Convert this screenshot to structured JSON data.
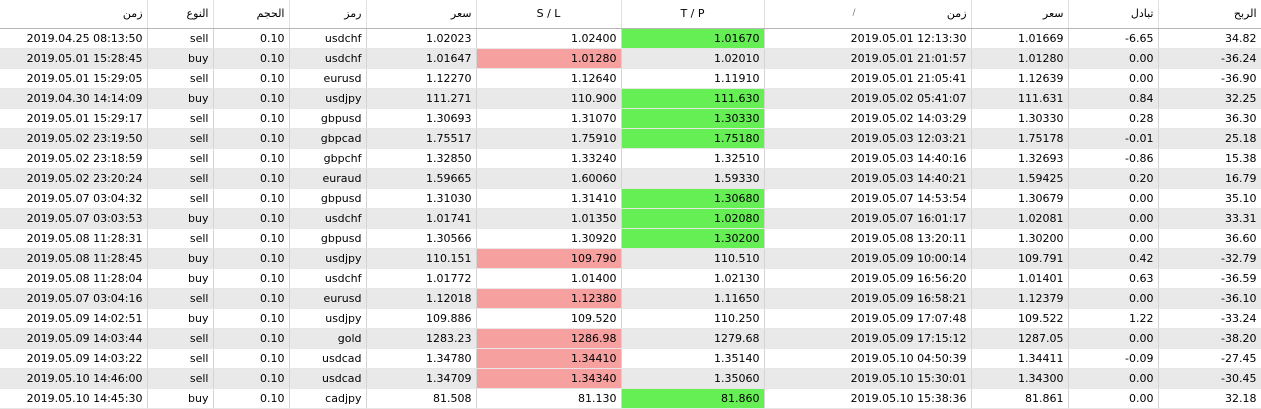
{
  "colors": {
    "header_bg": "#ffffff",
    "alt_row": "#e9e9e9",
    "sl_hit": "#f6a0a0",
    "tp_hit": "#66ee55"
  },
  "columns": [
    {
      "key": "open_time",
      "label": "زمن"
    },
    {
      "key": "type",
      "label": "النوع"
    },
    {
      "key": "volume",
      "label": "الحجم"
    },
    {
      "key": "symbol",
      "label": "رمز"
    },
    {
      "key": "open_price",
      "label": "سعر"
    },
    {
      "key": "sl",
      "label": "S / L"
    },
    {
      "key": "tp",
      "label": "T / P"
    },
    {
      "key": "close_time",
      "label": "زمن",
      "sort_icon": "/"
    },
    {
      "key": "close_price",
      "label": "سعر"
    },
    {
      "key": "swap",
      "label": "تبادل"
    },
    {
      "key": "profit",
      "label": "الربح"
    }
  ],
  "rows": [
    {
      "open_time": "2019.04.25 08:13:50",
      "type": "sell",
      "volume": "0.10",
      "symbol": "usdchf",
      "open_price": "1.02023",
      "sl": "1.02400",
      "tp": "1.01670",
      "close_time": "2019.05.01 12:13:30",
      "close_price": "1.01669",
      "swap": "-6.65",
      "profit": "34.82",
      "hit": "tp"
    },
    {
      "open_time": "2019.05.01 15:28:45",
      "type": "buy",
      "volume": "0.10",
      "symbol": "usdchf",
      "open_price": "1.01647",
      "sl": "1.01280",
      "tp": "1.02010",
      "close_time": "2019.05.01 21:01:57",
      "close_price": "1.01280",
      "swap": "0.00",
      "profit": "-36.24",
      "hit": "sl"
    },
    {
      "open_time": "2019.05.01 15:29:05",
      "type": "sell",
      "volume": "0.10",
      "symbol": "eurusd",
      "open_price": "1.12270",
      "sl": "1.12640",
      "tp": "1.11910",
      "close_time": "2019.05.01 21:05:41",
      "close_price": "1.12639",
      "swap": "0.00",
      "profit": "-36.90",
      "hit": ""
    },
    {
      "open_time": "2019.04.30 14:14:09",
      "type": "buy",
      "volume": "0.10",
      "symbol": "usdjpy",
      "open_price": "111.271",
      "sl": "110.900",
      "tp": "111.630",
      "close_time": "2019.05.02 05:41:07",
      "close_price": "111.631",
      "swap": "0.84",
      "profit": "32.25",
      "hit": "tp"
    },
    {
      "open_time": "2019.05.01 15:29:17",
      "type": "sell",
      "volume": "0.10",
      "symbol": "gbpusd",
      "open_price": "1.30693",
      "sl": "1.31070",
      "tp": "1.30330",
      "close_time": "2019.05.02 14:03:29",
      "close_price": "1.30330",
      "swap": "0.28",
      "profit": "36.30",
      "hit": "tp"
    },
    {
      "open_time": "2019.05.02 23:19:50",
      "type": "sell",
      "volume": "0.10",
      "symbol": "gbpcad",
      "open_price": "1.75517",
      "sl": "1.75910",
      "tp": "1.75180",
      "close_time": "2019.05.03 12:03:21",
      "close_price": "1.75178",
      "swap": "-0.01",
      "profit": "25.18",
      "hit": "tp"
    },
    {
      "open_time": "2019.05.02 23:18:59",
      "type": "sell",
      "volume": "0.10",
      "symbol": "gbpchf",
      "open_price": "1.32850",
      "sl": "1.33240",
      "tp": "1.32510",
      "close_time": "2019.05.03 14:40:16",
      "close_price": "1.32693",
      "swap": "-0.86",
      "profit": "15.38",
      "hit": ""
    },
    {
      "open_time": "2019.05.02 23:20:24",
      "type": "sell",
      "volume": "0.10",
      "symbol": "euraud",
      "open_price": "1.59665",
      "sl": "1.60060",
      "tp": "1.59330",
      "close_time": "2019.05.03 14:40:21",
      "close_price": "1.59425",
      "swap": "0.20",
      "profit": "16.79",
      "hit": ""
    },
    {
      "open_time": "2019.05.07 03:04:32",
      "type": "sell",
      "volume": "0.10",
      "symbol": "gbpusd",
      "open_price": "1.31030",
      "sl": "1.31410",
      "tp": "1.30680",
      "close_time": "2019.05.07 14:53:54",
      "close_price": "1.30679",
      "swap": "0.00",
      "profit": "35.10",
      "hit": "tp"
    },
    {
      "open_time": "2019.05.07 03:03:53",
      "type": "buy",
      "volume": "0.10",
      "symbol": "usdchf",
      "open_price": "1.01741",
      "sl": "1.01350",
      "tp": "1.02080",
      "close_time": "2019.05.07 16:01:17",
      "close_price": "1.02081",
      "swap": "0.00",
      "profit": "33.31",
      "hit": "tp"
    },
    {
      "open_time": "2019.05.08 11:28:31",
      "type": "sell",
      "volume": "0.10",
      "symbol": "gbpusd",
      "open_price": "1.30566",
      "sl": "1.30920",
      "tp": "1.30200",
      "close_time": "2019.05.08 13:20:11",
      "close_price": "1.30200",
      "swap": "0.00",
      "profit": "36.60",
      "hit": "tp"
    },
    {
      "open_time": "2019.05.08 11:28:45",
      "type": "buy",
      "volume": "0.10",
      "symbol": "usdjpy",
      "open_price": "110.151",
      "sl": "109.790",
      "tp": "110.510",
      "close_time": "2019.05.09 10:00:14",
      "close_price": "109.791",
      "swap": "0.42",
      "profit": "-32.79",
      "hit": "sl"
    },
    {
      "open_time": "2019.05.08 11:28:04",
      "type": "buy",
      "volume": "0.10",
      "symbol": "usdchf",
      "open_price": "1.01772",
      "sl": "1.01400",
      "tp": "1.02130",
      "close_time": "2019.05.09 16:56:20",
      "close_price": "1.01401",
      "swap": "0.63",
      "profit": "-36.59",
      "hit": ""
    },
    {
      "open_time": "2019.05.07 03:04:16",
      "type": "sell",
      "volume": "0.10",
      "symbol": "eurusd",
      "open_price": "1.12018",
      "sl": "1.12380",
      "tp": "1.11650",
      "close_time": "2019.05.09 16:58:21",
      "close_price": "1.12379",
      "swap": "0.00",
      "profit": "-36.10",
      "hit": "sl"
    },
    {
      "open_time": "2019.05.09 14:02:51",
      "type": "buy",
      "volume": "0.10",
      "symbol": "usdjpy",
      "open_price": "109.886",
      "sl": "109.520",
      "tp": "110.250",
      "close_time": "2019.05.09 17:07:48",
      "close_price": "109.522",
      "swap": "1.22",
      "profit": "-33.24",
      "hit": ""
    },
    {
      "open_time": "2019.05.09 14:03:44",
      "type": "sell",
      "volume": "0.10",
      "symbol": "gold",
      "open_price": "1283.23",
      "sl": "1286.98",
      "tp": "1279.68",
      "close_time": "2019.05.09 17:15:12",
      "close_price": "1287.05",
      "swap": "0.00",
      "profit": "-38.20",
      "hit": "sl"
    },
    {
      "open_time": "2019.05.09 14:03:22",
      "type": "sell",
      "volume": "0.10",
      "symbol": "usdcad",
      "open_price": "1.34780",
      "sl": "1.34410",
      "tp": "1.35140",
      "close_time": "2019.05.10 04:50:39",
      "close_price": "1.34411",
      "swap": "-0.09",
      "profit": "-27.45",
      "hit": "sl"
    },
    {
      "open_time": "2019.05.10 14:46:00",
      "type": "sell",
      "volume": "0.10",
      "symbol": "usdcad",
      "open_price": "1.34709",
      "sl": "1.34340",
      "tp": "1.35060",
      "close_time": "2019.05.10 15:30:01",
      "close_price": "1.34300",
      "swap": "0.00",
      "profit": "-30.45",
      "hit": "sl"
    },
    {
      "open_time": "2019.05.10 14:45:30",
      "type": "buy",
      "volume": "0.10",
      "symbol": "cadjpy",
      "open_price": "81.508",
      "sl": "81.130",
      "tp": "81.860",
      "close_time": "2019.05.10 15:38:36",
      "close_price": "81.861",
      "swap": "0.00",
      "profit": "32.18",
      "hit": "tp"
    }
  ]
}
